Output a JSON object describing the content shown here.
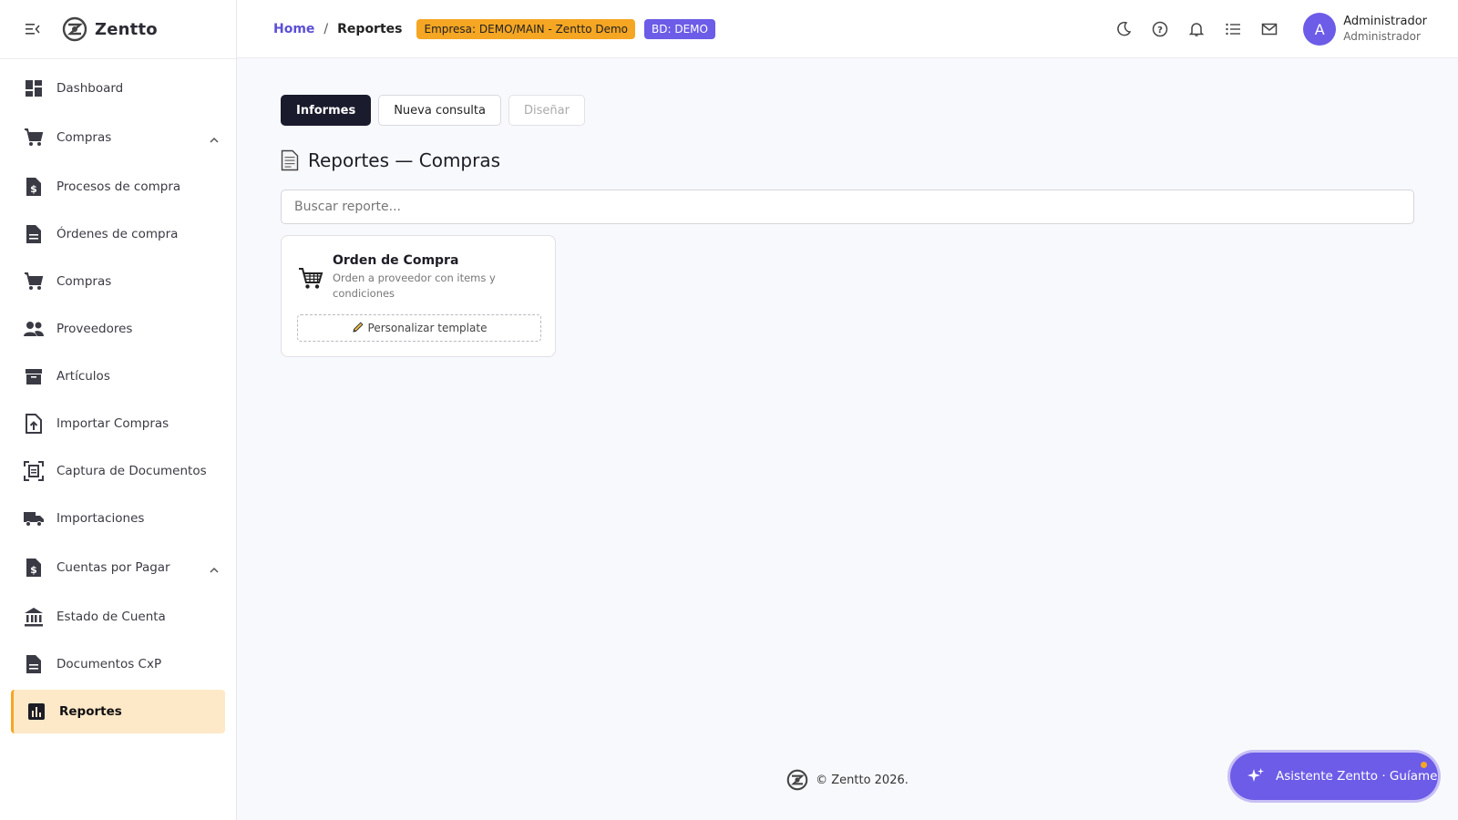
{
  "app": {
    "brand": "Zentto"
  },
  "sidebar": {
    "items": [
      {
        "label": "Dashboard",
        "icon": "dashboard-icon"
      },
      {
        "label": "Compras",
        "icon": "cart-icon",
        "expandable": true
      },
      {
        "label": "Procesos de compra",
        "icon": "invoice-dollar-icon"
      },
      {
        "label": "Órdenes de compra",
        "icon": "document-icon"
      },
      {
        "label": "Compras",
        "icon": "cart-icon"
      },
      {
        "label": "Proveedores",
        "icon": "people-icon"
      },
      {
        "label": "Artículos",
        "icon": "archive-icon"
      },
      {
        "label": "Importar Compras",
        "icon": "file-upload-icon"
      },
      {
        "label": "Captura de Documentos",
        "icon": "document-scanner-icon"
      },
      {
        "label": "Importaciones",
        "icon": "truck-icon"
      },
      {
        "label": "Cuentas por Pagar",
        "icon": "invoice-dollar-icon",
        "expandable": true
      },
      {
        "label": "Estado de Cuenta",
        "icon": "bank-icon"
      },
      {
        "label": "Documentos CxP",
        "icon": "document-icon"
      },
      {
        "label": "Reportes",
        "icon": "bar-chart-icon",
        "active": true
      }
    ]
  },
  "topbar": {
    "breadcrumb_home": "Home",
    "breadcrumb_sep": "/",
    "breadcrumb_current": "Reportes",
    "badge_empresa": "Empresa: DEMO/MAIN - Zentto Demo",
    "badge_bd": "BD: DEMO",
    "user_initial": "A",
    "user_name": "Administrador",
    "user_role": "Administrador"
  },
  "main": {
    "tabs": [
      {
        "label": "Informes",
        "state": "active"
      },
      {
        "label": "Nueva consulta",
        "state": "normal"
      },
      {
        "label": "Diseñar",
        "state": "disabled"
      }
    ],
    "title": "Reportes — Compras",
    "search_placeholder": "Buscar reporte...",
    "cards": [
      {
        "title": "Orden de Compra",
        "description": "Orden a proveedor con items y condiciones",
        "button": "Personalizar template"
      }
    ]
  },
  "footer": {
    "text": "© Zentto 2026."
  },
  "assistant": {
    "label": "Asistente Zentto · Guíame"
  },
  "colors": {
    "accent": "#6c5ce7",
    "warning": "#f5a623",
    "dark": "#1b1b2e",
    "active_bg": "#fde8c8"
  }
}
